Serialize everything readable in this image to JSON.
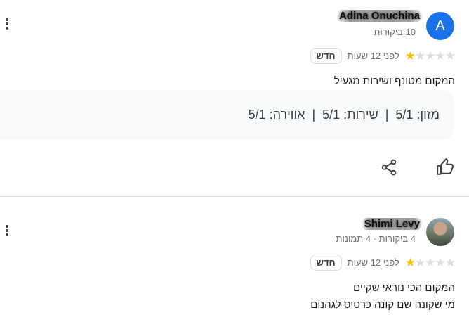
{
  "reviews": [
    {
      "author": "Adina Onuchina",
      "avatar_letter": "A",
      "meta": "10 ביקורות",
      "stars": 1,
      "stars_total": 5,
      "time": "לפני 12 שעות",
      "badge": "חדש",
      "text": "המקום מטונף ושירות מגעיל",
      "sub_ratings": [
        {
          "label": "מזון:",
          "value": "5/1"
        },
        {
          "label": "שירות:",
          "value": "5/1"
        },
        {
          "label": "אווירה:",
          "value": "5/1"
        }
      ],
      "separator": "|"
    },
    {
      "author": "Shimi Levy",
      "meta": "4 ביקורות · 4 תמונות",
      "stars": 1,
      "stars_total": 5,
      "time": "לפני 12 שעות",
      "badge": "חדש",
      "text_line_1": "המקום הכי נוראי שקיים",
      "text_line_2": "מי שקונה שם קונה כרטיס לגהנום"
    }
  ],
  "icons": {
    "more": "more-vert-icon",
    "like": "thumb-up-icon",
    "share": "share-icon",
    "star_color": "#fbbc04",
    "avatar_color": "#1a73e8"
  }
}
